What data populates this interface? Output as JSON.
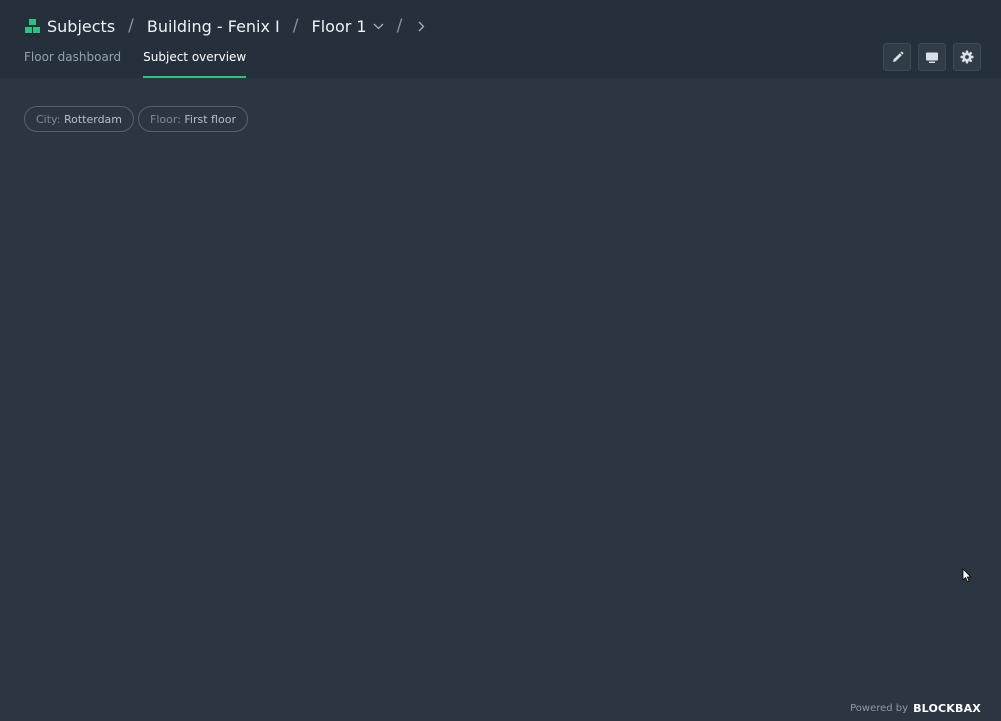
{
  "breadcrumb": {
    "items": [
      {
        "label": "Subjects",
        "icon": "subjects-icon"
      },
      {
        "label": "Building - Fenix I"
      },
      {
        "label": "Floor 1",
        "icon": "chevron-down-icon"
      }
    ],
    "separator": "/",
    "next_icon": "chevron-right-icon"
  },
  "tabs": [
    {
      "label": "Floor dashboard",
      "active": false
    },
    {
      "label": "Subject overview",
      "active": true
    }
  ],
  "toolbar": {
    "buttons": [
      {
        "icon": "pencil-icon",
        "name": "edit"
      },
      {
        "icon": "monitor-icon",
        "name": "display"
      },
      {
        "icon": "gear-icon",
        "name": "settings"
      }
    ]
  },
  "filters": [
    {
      "key": "City:",
      "value": "Rotterdam"
    },
    {
      "key": "Floor:",
      "value": "First floor"
    }
  ],
  "footer": {
    "powered_by": "Powered by",
    "brand": "BLOCKBAX"
  },
  "colors": {
    "background": "#2c3643",
    "header_background": "#25303c",
    "accent": "#2ec27e"
  }
}
